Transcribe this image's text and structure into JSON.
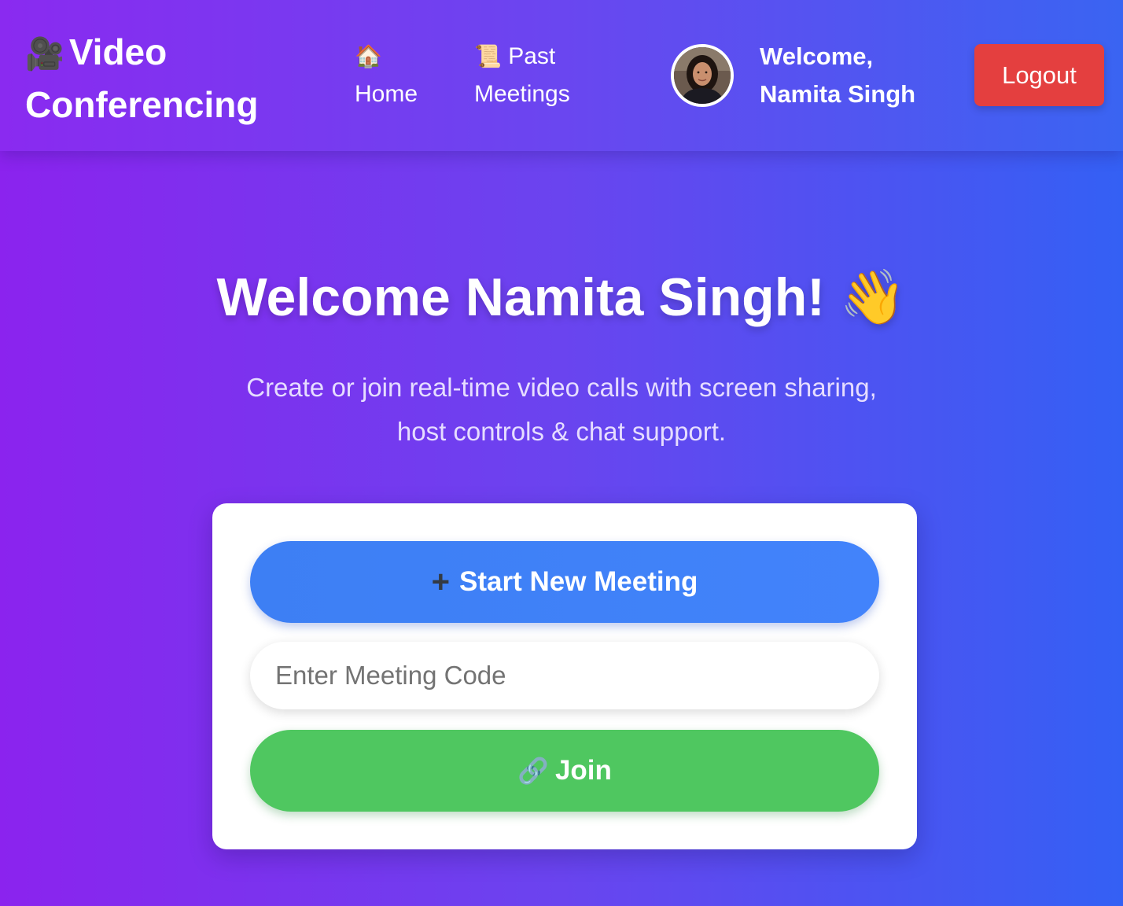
{
  "header": {
    "brand_icon": "🎥",
    "brand_line1": "Video",
    "brand_line2": "Conferencing",
    "nav": [
      {
        "icon": "🏠",
        "label": "Home",
        "icon_name": "house-icon"
      },
      {
        "icon": "📜",
        "label_line1": "Past",
        "label_line2": "Meetings",
        "icon_name": "scroll-icon"
      }
    ],
    "welcome_line1": "Welcome,",
    "welcome_line2": "Namita Singh",
    "logout_label": "Logout"
  },
  "hero": {
    "title": "Welcome Namita Singh! 👋",
    "subtitle_line1": "Create or join real-time video calls with screen sharing,",
    "subtitle_line2": "host controls & chat support."
  },
  "card": {
    "start_icon": "+",
    "start_label": "Start New Meeting",
    "code_placeholder": "Enter Meeting Code",
    "code_value": "",
    "join_icon": "🔗",
    "join_label": "Join"
  },
  "colors": {
    "gradient_start": "#8b23ee",
    "gradient_end": "#3460f4",
    "logout": "#e43f3f",
    "start_button": "#4283fb",
    "join_button": "#4fc760"
  }
}
